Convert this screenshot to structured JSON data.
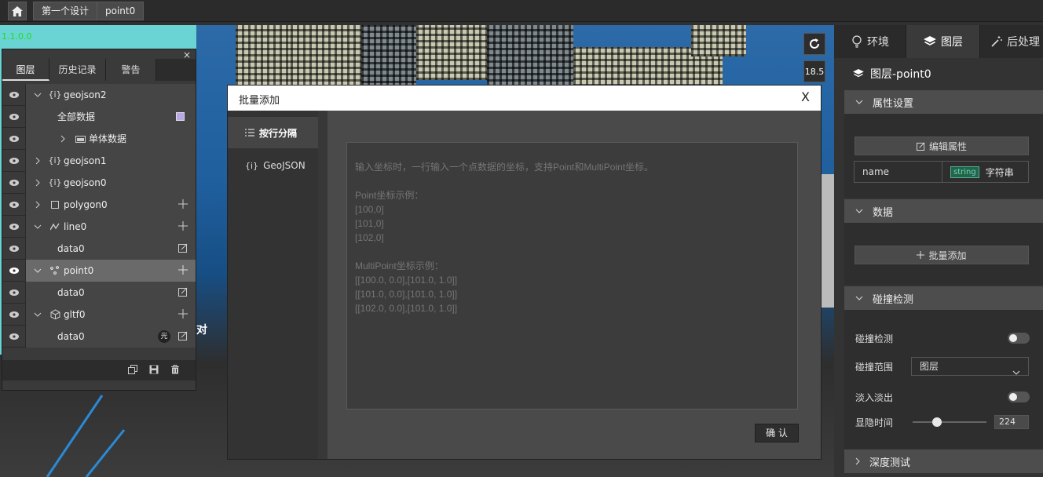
{
  "topbar": {
    "breadcrumbs": [
      "第一个设计",
      "point0"
    ]
  },
  "scene": {
    "green_text": "1.1.0.0",
    "zoom_level": "18.5",
    "overlay_char": "对"
  },
  "layers_panel": {
    "close_label": "×",
    "tabs": [
      "图层",
      "历史记录",
      "警告"
    ],
    "rows": [
      {
        "label": "geojson2",
        "type": "geojson",
        "expanded": true
      },
      {
        "label": "全部数据",
        "type": "data-all"
      },
      {
        "label": "单体数据",
        "type": "folder"
      },
      {
        "label": "geojson1",
        "type": "geojson"
      },
      {
        "label": "geojson0",
        "type": "geojson"
      },
      {
        "label": "polygon0",
        "type": "polygon"
      },
      {
        "label": "line0",
        "type": "line"
      },
      {
        "label": "data0",
        "type": "data"
      },
      {
        "label": "point0",
        "type": "point",
        "selected": true
      },
      {
        "label": "data0",
        "type": "data"
      },
      {
        "label": "gltf0",
        "type": "gltf"
      },
      {
        "label": "data0",
        "type": "data",
        "badge": "光"
      }
    ]
  },
  "modal": {
    "title": "批量添加",
    "close_label": "X",
    "side_items": [
      "按行分隔",
      "GeoJSON"
    ],
    "textarea_placeholder": "输入坐标时，一行输入一个点数据的坐标，支持Point和MultiPoint坐标。\n\nPoint坐标示例：\n[100,0]\n[101,0]\n[102,0]\n\nMultiPoint坐标示例：\n[[100.0, 0.0],[101.0, 1.0]]\n[[101.0, 0.0],[101.0, 1.0]]\n[[102.0, 0.0],[101.0, 1.0]]",
    "confirm_label": "确 认"
  },
  "right_panel": {
    "tabs": [
      "环境",
      "图层",
      "后处理"
    ],
    "active_tab": "图层",
    "layer_title": "图层-point0",
    "sections": {
      "properties": "属性设置",
      "data": "数据",
      "collision": "碰撞检测",
      "depth": "深度测试"
    },
    "edit_props_label": "编辑属性",
    "attr": {
      "name": "name",
      "type_tag": "string",
      "type_label": "字符串"
    },
    "batch_add_label": "批量添加",
    "collision_fields": {
      "collision_detect": "碰撞检测",
      "collision_range": "碰撞范围",
      "collision_range_value": "图层",
      "fade": "淡入淡出",
      "fade_time": "显隐时间",
      "fade_time_value": "224",
      "fade_slider_fraction": 0.33
    }
  }
}
